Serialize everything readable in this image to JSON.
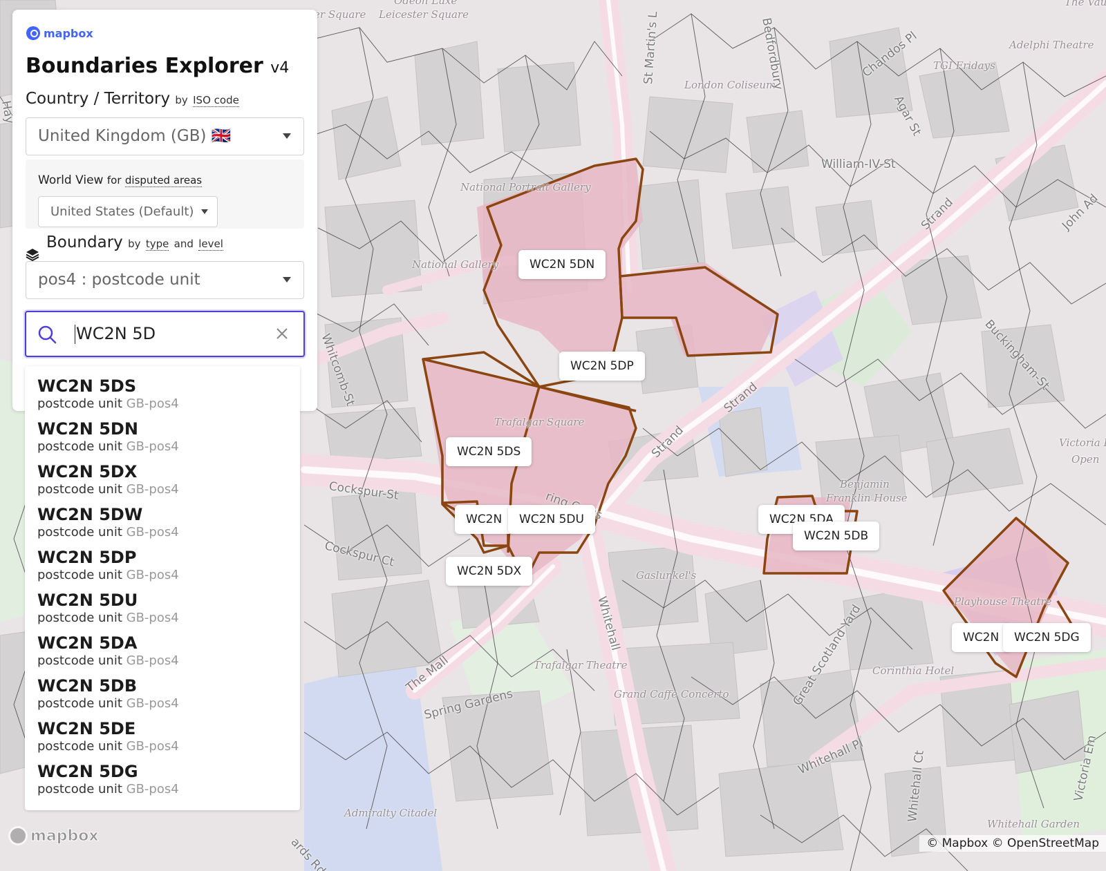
{
  "panel": {
    "brand": "mapbox",
    "title": "Boundaries Explorer",
    "version": "v4",
    "country": {
      "heading": "Country / Territory",
      "by": "by",
      "by_link": "ISO code",
      "selected": "United Kingdom (GB) 🇬🇧"
    },
    "worldview": {
      "label": "World View",
      "for": "for",
      "for_link": "disputed areas",
      "selected": "United States (Default)"
    },
    "boundary": {
      "heading": "Boundary",
      "by": "by",
      "type_link": "type",
      "and": "and",
      "level_link": "level",
      "selected": "pos4 : postcode unit"
    },
    "search": {
      "value": "WC2N 5D"
    }
  },
  "results": [
    {
      "code": "WC2N 5DS",
      "type": "postcode unit",
      "id": "GB-pos4"
    },
    {
      "code": "WC2N 5DN",
      "type": "postcode unit",
      "id": "GB-pos4"
    },
    {
      "code": "WC2N 5DX",
      "type": "postcode unit",
      "id": "GB-pos4"
    },
    {
      "code": "WC2N 5DW",
      "type": "postcode unit",
      "id": "GB-pos4"
    },
    {
      "code": "WC2N 5DP",
      "type": "postcode unit",
      "id": "GB-pos4"
    },
    {
      "code": "WC2N 5DU",
      "type": "postcode unit",
      "id": "GB-pos4"
    },
    {
      "code": "WC2N 5DA",
      "type": "postcode unit",
      "id": "GB-pos4"
    },
    {
      "code": "WC2N 5DB",
      "type": "postcode unit",
      "id": "GB-pos4"
    },
    {
      "code": "WC2N 5DE",
      "type": "postcode unit",
      "id": "GB-pos4"
    },
    {
      "code": "WC2N 5DG",
      "type": "postcode unit",
      "id": "GB-pos4"
    }
  ],
  "map": {
    "colors": {
      "boundary": "#8b4511",
      "highlight_fill": "#e7b9c6",
      "block": "#d3d1d2",
      "road": "#f7dfe7",
      "park": "#d9ebdc",
      "water": "#c9d3ee"
    },
    "postcode_tags": [
      "WC2N 5DN",
      "WC2N 5DP",
      "WC2N 5DS",
      "WC2N",
      "WC2N 5DU",
      "WC2N 5DX",
      "WC2N 5DA",
      "WC2N 5DB",
      "WC2N",
      "WC2N 5DG"
    ],
    "poi_labels": [
      "er Square",
      "Leicester Square",
      "Odeon Luxe",
      "London Coliseum",
      "TGI Fridays",
      "Adelphi Theatre",
      "The Vaud",
      "National Portrait Gallery",
      "National Gallery",
      "Trafalgar Square",
      "Benjamin",
      "Franklin House",
      "Victoria E",
      "Open",
      "Gaslunkel's",
      "Playhouse Theatre",
      "Corinthia Hotel",
      "Trafalgar Theatre",
      "Grand Caffe Concerto",
      "Admiralty Citadel",
      "Whitehall Garden"
    ],
    "road_labels": [
      "St Martin's L",
      "Bedfordbury",
      "Chandos Pl",
      "Agar St",
      "William-IV-St",
      "Strand",
      "John Ad",
      "Buckingham-St",
      "Strand",
      "Strand",
      "Whitcomb-St",
      "Cockspur-St",
      "Cockspur Ct",
      "ring Cross",
      "Whitehall",
      "The Mall",
      "Spring Gardens",
      "Great Scotland Yard",
      "Whitehall Pl",
      "Whitehall Ct",
      "Victoria Em",
      "ards Rd",
      "Hay"
    ]
  },
  "footer": {
    "logo": "mapbox",
    "attribution": "© Mapbox © OpenStreetMap"
  }
}
